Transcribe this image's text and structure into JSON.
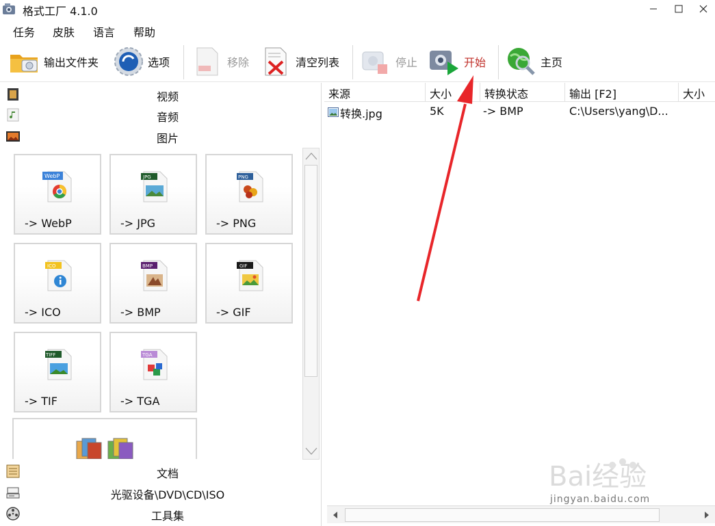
{
  "window": {
    "title": "格式工厂 4.1.0"
  },
  "menu": [
    "任务",
    "皮肤",
    "语言",
    "帮助"
  ],
  "toolbar": {
    "output_folder": "输出文件夹",
    "options": "选项",
    "remove": "移除",
    "clear_list": "清空列表",
    "stop": "停止",
    "start": "开始",
    "home": "主页"
  },
  "categories": {
    "video": "视频",
    "audio": "音频",
    "image": "图片",
    "document": "文档",
    "optical": "光驱设备\\DVD\\CD\\ISO",
    "tools": "工具集"
  },
  "formats": [
    {
      "label": "-> WebP",
      "icon": "webp-file-icon",
      "tag": "WebP"
    },
    {
      "label": "-> JPG",
      "icon": "jpg-file-icon",
      "tag": "JPG"
    },
    {
      "label": "-> PNG",
      "icon": "png-file-icon",
      "tag": "PNG"
    },
    {
      "label": "-> ICO",
      "icon": "ico-file-icon",
      "tag": "ICO"
    },
    {
      "label": "-> BMP",
      "icon": "bmp-file-icon",
      "tag": "BMP"
    },
    {
      "label": "-> GIF",
      "icon": "gif-file-icon",
      "tag": "GIF"
    },
    {
      "label": "-> TIF",
      "icon": "tiff-file-icon",
      "tag": "TIFF"
    },
    {
      "label": "-> TGA",
      "icon": "tga-file-icon",
      "tag": "TGA"
    }
  ],
  "table": {
    "columns": [
      "来源",
      "大小",
      "转换状态",
      "输出 [F2]",
      "大小"
    ],
    "rows": [
      {
        "source": "转换.jpg",
        "size": "5K",
        "status": "-> BMP",
        "output": "C:\\Users\\yang\\D..."
      }
    ]
  },
  "watermark": {
    "brand": "Bai经验",
    "url": "jingyan.baidu.com"
  },
  "colors": {
    "start_label": "#c0302a",
    "annotation_arrow": "#e8262a"
  }
}
